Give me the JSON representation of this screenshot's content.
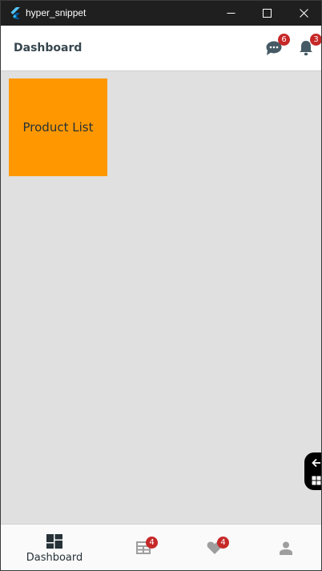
{
  "window": {
    "title": "hyper_snippet",
    "icons": {
      "app": "flutter-icon",
      "minimize": "minimize-icon",
      "maximize": "maximize-icon",
      "close": "close-icon"
    }
  },
  "appbar": {
    "title": "Dashboard",
    "actions": [
      {
        "icon": "chat-icon",
        "badge": "6"
      },
      {
        "icon": "bell-icon",
        "badge": "3"
      }
    ]
  },
  "content": {
    "tiles": [
      {
        "label": "Product List",
        "color": "#ff9800"
      }
    ]
  },
  "floating_control": {
    "icons": [
      "arrow-left-icon",
      "widgets-icon"
    ]
  },
  "bottom_nav": {
    "items": [
      {
        "icon": "dashboard-icon",
        "label": "Dashboard",
        "badge": "",
        "active": true
      },
      {
        "icon": "table-icon",
        "label": "",
        "badge": "4",
        "active": false
      },
      {
        "icon": "heart-icon",
        "label": "",
        "badge": "4",
        "active": false
      },
      {
        "icon": "person-icon",
        "label": "",
        "badge": "",
        "active": false
      }
    ]
  },
  "colors": {
    "accent": "#ff9800",
    "badge": "#c62828",
    "active_icon": "#263238",
    "inactive_icon": "#9e9e9e"
  }
}
